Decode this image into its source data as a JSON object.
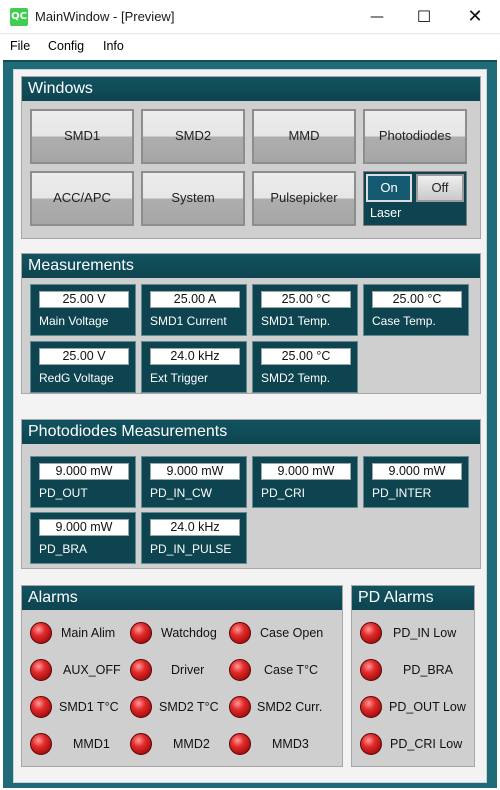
{
  "app": {
    "title": "MainWindow - [Preview]",
    "icon_text": "QC",
    "icon": "qt-creator-icon"
  },
  "titlebar": {
    "minimize": "—",
    "maximize": "☐",
    "close": "✕"
  },
  "menu": [
    "File",
    "Config",
    "Info"
  ],
  "windows": {
    "title": "Windows",
    "buttons": [
      "SMD1",
      "SMD2",
      "MMD",
      "Photodiodes",
      "ACC/APC",
      "System",
      "Pulsepicker"
    ],
    "laser": {
      "on_label": "On",
      "off_label": "Off",
      "label": "Laser",
      "state": "On"
    }
  },
  "measurements": {
    "title": "Measurements",
    "items": [
      {
        "value": "25.00 V",
        "label": "Main Voltage"
      },
      {
        "value": "25.00 A",
        "label": "SMD1 Current"
      },
      {
        "value": "25.00 °C",
        "label": "SMD1 Temp."
      },
      {
        "value": "25.00 °C",
        "label": "Case Temp."
      },
      {
        "value": "25.00 V",
        "label": "RedG Voltage"
      },
      {
        "value": "24.0 kHz",
        "label": "Ext Trigger"
      },
      {
        "value": "25.00 °C",
        "label": "SMD2 Temp."
      }
    ]
  },
  "pd_measurements": {
    "title": "Photodiodes Measurements",
    "items": [
      {
        "value": "9.000 mW",
        "label": "PD_OUT"
      },
      {
        "value": "9.000 mW",
        "label": "PD_IN_CW"
      },
      {
        "value": "9.000 mW",
        "label": "PD_CRI"
      },
      {
        "value": "9.000 mW",
        "label": "PD_INTER"
      },
      {
        "value": "9.000 mW",
        "label": "PD_BRA"
      },
      {
        "value": "24.0 kHz",
        "label": "PD_IN_PULSE"
      }
    ]
  },
  "alarms": {
    "title": "Alarms",
    "items": [
      "Main Alim",
      "Watchdog",
      "Case Open",
      "AUX_OFF",
      "Driver",
      "Case T°C",
      "SMD1 T°C",
      "SMD2 T°C",
      "SMD2 Curr.",
      "MMD1",
      "MMD2",
      "MMD3"
    ]
  },
  "pd_alarms": {
    "title": "PD Alarms",
    "items": [
      "PD_IN Low",
      "PD_BRA",
      "PD_OUT Low",
      "PD_CRI Low"
    ]
  },
  "colors": {
    "header": "#0d4450",
    "background": "#1f6b77",
    "alarm_led": "#d32222"
  }
}
